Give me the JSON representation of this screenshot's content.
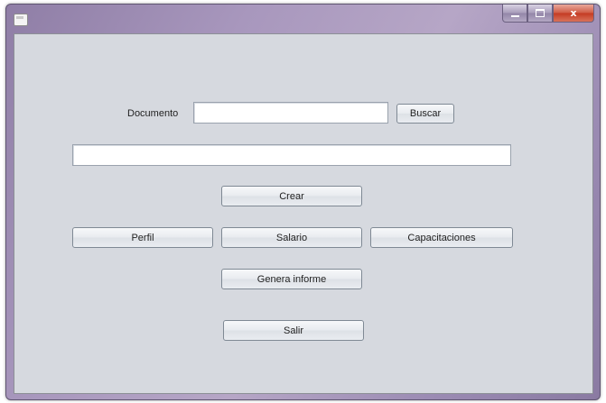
{
  "window": {
    "title": "",
    "caption_buttons": {
      "minimize": "minimize-icon",
      "maximize": "maximize-icon",
      "close": "x"
    }
  },
  "search": {
    "label": "Documento",
    "value": "",
    "button": "Buscar"
  },
  "result_field": {
    "value": ""
  },
  "buttons": {
    "crear": "Crear",
    "perfil": "Perfil",
    "salario": "Salario",
    "capacitaciones": "Capacitaciones",
    "genera_informe": "Genera informe",
    "salir": "Salir"
  },
  "colors": {
    "client_bg": "#d6d9df",
    "frame": "#9b8bb3",
    "close_button": "#c43a22"
  }
}
